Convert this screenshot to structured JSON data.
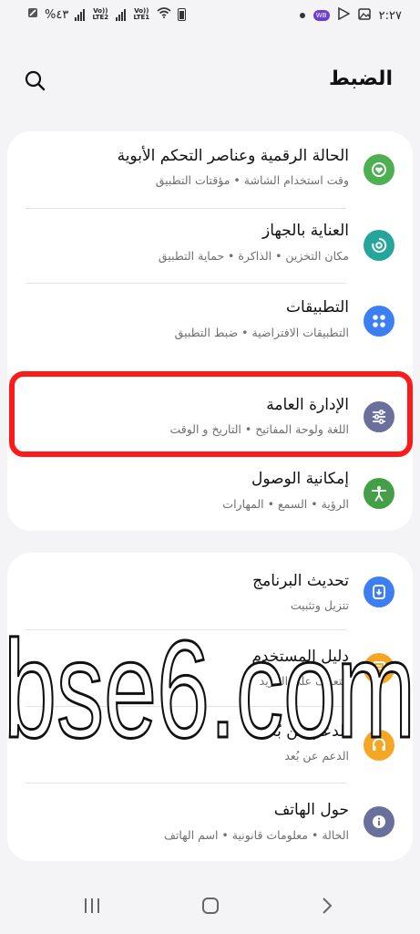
{
  "status_bar": {
    "battery_percent": "%٤٣",
    "sim2_label": "Vo)) LTE2",
    "sim1_label": "Vo)) LTE1",
    "clock": "٢:٢٧",
    "icons": [
      "battery-saver-icon",
      "signal-icon",
      "signal-icon",
      "wifi-icon",
      "battery-icon",
      "notification-dot-icon",
      "app-badge-icon",
      "play-store-icon",
      "gallery-icon"
    ]
  },
  "header": {
    "title": "الضبط"
  },
  "groups": [
    {
      "items": [
        {
          "title": "الحالة الرقمية وعناصر التحكم الأبوية",
          "subtitle": "وقت استخدام الشاشة • مؤقتات التطبيق",
          "icon": "heart-shield-icon",
          "color": "#4caf50"
        },
        {
          "title": "العناية بالجهاز",
          "subtitle": "مكان التخزين • الذاكرة • حماية التطبيق",
          "icon": "device-care-icon",
          "color": "#26a69a"
        },
        {
          "title": "التطبيقات",
          "subtitle": "التطبيقات الافتراضية • ضبط التطبيق",
          "icon": "apps-grid-icon",
          "color": "#3d7ef5"
        },
        {
          "title": "الإدارة العامة",
          "subtitle": "اللغة ولوحة المفاتيح • التاريخ و الوقت",
          "icon": "sliders-icon",
          "color": "#6b6f9c"
        },
        {
          "title": "إمكانية الوصول",
          "subtitle": "الرؤية • السمع • المهارات",
          "icon": "accessibility-icon",
          "color": "#43a047"
        }
      ]
    },
    {
      "items": [
        {
          "title": "تحديث البرنامج",
          "subtitle": "تنزيل وتثبيت",
          "icon": "software-update-icon",
          "color": "#3d7ef5"
        },
        {
          "title": "دليل المستخدم",
          "subtitle": "التعرف على المزيد",
          "icon": "user-manual-icon",
          "color": "#f5a623"
        },
        {
          "title": "الدعم عن بُعد",
          "subtitle": "الدعم عن بُعد",
          "icon": "remote-support-icon",
          "color": "#f5a623"
        },
        {
          "title": "حول الهاتف",
          "subtitle": "الحالة • معلومات قانونية • اسم الهاتف",
          "icon": "info-icon",
          "color": "#6b6f9c"
        }
      ]
    }
  ],
  "watermark": {
    "text": "bse6.com"
  },
  "nav_bar": {
    "icons": [
      "recent-apps-icon",
      "home-icon",
      "back-icon"
    ]
  }
}
